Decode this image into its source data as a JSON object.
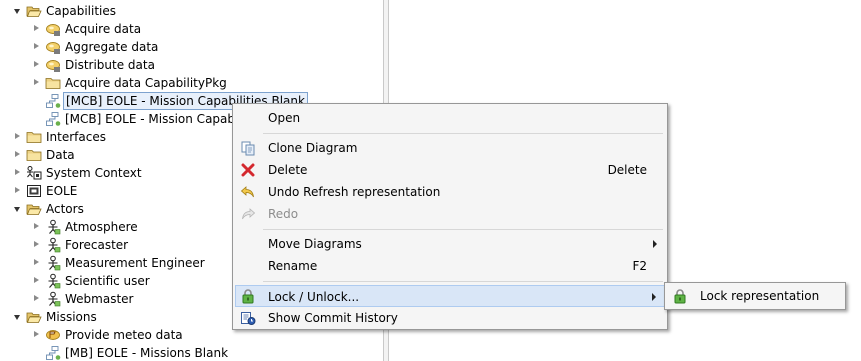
{
  "tree": {
    "items": [
      {
        "label": "Capabilities",
        "icon": "folder-open-icon",
        "state": "expanded"
      },
      {
        "label": "Acquire data",
        "icon": "capability-icon",
        "state": "collapsed"
      },
      {
        "label": "Aggregate data",
        "icon": "capability-icon",
        "state": "collapsed"
      },
      {
        "label": "Distribute data",
        "icon": "capability-icon",
        "state": "collapsed"
      },
      {
        "label": "Acquire data CapabilityPkg",
        "icon": "folder-icon",
        "state": "collapsed"
      },
      {
        "label": "[MCB] EOLE - Mission Capabilities Blank",
        "icon": "diagram-icon",
        "state": "leaf",
        "selected": true
      },
      {
        "label": "[MCB] EOLE - Mission Capabilities Blank",
        "icon": "diagram-icon",
        "state": "leaf"
      },
      {
        "label": "Interfaces",
        "icon": "folder-icon",
        "state": "collapsed"
      },
      {
        "label": "Data",
        "icon": "folder-icon",
        "state": "collapsed"
      },
      {
        "label": "System Context",
        "icon": "system-context-icon",
        "state": "collapsed"
      },
      {
        "label": "EOLE",
        "icon": "system-icon",
        "state": "collapsed"
      },
      {
        "label": "Actors",
        "icon": "folder-open-icon",
        "state": "expanded"
      },
      {
        "label": "Atmosphere",
        "icon": "actor-icon",
        "state": "collapsed"
      },
      {
        "label": "Forecaster",
        "icon": "actor-icon",
        "state": "collapsed"
      },
      {
        "label": "Measurement Engineer",
        "icon": "actor-icon",
        "state": "collapsed"
      },
      {
        "label": "Scientific user",
        "icon": "actor-icon",
        "state": "collapsed"
      },
      {
        "label": "Webmaster",
        "icon": "actor-icon",
        "state": "collapsed"
      },
      {
        "label": "Missions",
        "icon": "folder-open-icon",
        "state": "expanded"
      },
      {
        "label": "Provide meteo data",
        "icon": "mission-icon",
        "state": "collapsed"
      },
      {
        "label": "[MB] EOLE - Missions Blank",
        "icon": "diagram-icon",
        "state": "leaf"
      }
    ]
  },
  "context_menu": {
    "items": [
      {
        "label": "Open",
        "icon": "",
        "accelerator": ""
      },
      {
        "label": "Clone Diagram",
        "icon": "clone-icon",
        "accelerator": ""
      },
      {
        "label": "Delete",
        "icon": "delete-icon",
        "accelerator": "Delete"
      },
      {
        "label": "Undo Refresh representation",
        "icon": "undo-icon",
        "accelerator": ""
      },
      {
        "label": "Redo",
        "icon": "redo-icon",
        "accelerator": "",
        "disabled": true
      },
      {
        "label": "Move Diagrams",
        "icon": "",
        "accelerator": "",
        "submenu": true
      },
      {
        "label": "Rename",
        "icon": "",
        "accelerator": "F2"
      },
      {
        "label": "Lock / Unlock...",
        "icon": "lock-icon",
        "accelerator": "",
        "submenu": true,
        "highlighted": true
      },
      {
        "label": "Show Commit History",
        "icon": "commit-history-icon",
        "accelerator": ""
      }
    ]
  },
  "submenu": {
    "items": [
      {
        "label": "Lock representation",
        "icon": "lock-icon"
      }
    ]
  },
  "colors": {
    "selection_border": "#7da2ce",
    "menu_background": "#f5f5f5",
    "menu_highlight": "#d9e6f7"
  }
}
